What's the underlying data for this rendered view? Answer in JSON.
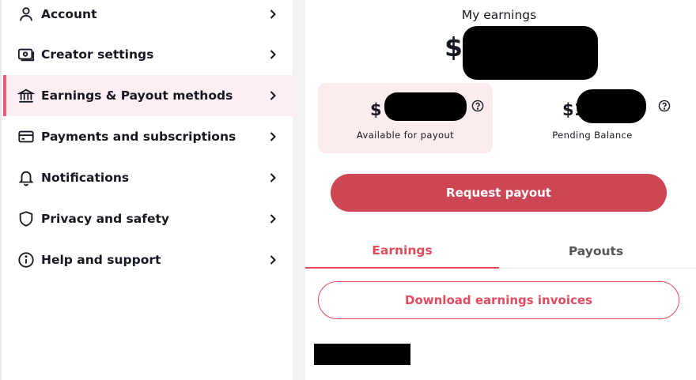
{
  "sidebar": {
    "items": [
      {
        "label": "Account",
        "icon": "person-icon"
      },
      {
        "label": "Creator settings",
        "icon": "money-icon"
      },
      {
        "label": "Earnings & Payout methods",
        "icon": "bank-icon"
      },
      {
        "label": "Payments and subscriptions",
        "icon": "card-icon"
      },
      {
        "label": "Notifications",
        "icon": "bell-icon"
      },
      {
        "label": "Privacy and safety",
        "icon": "shield-icon"
      },
      {
        "label": "Help and support",
        "icon": "info-icon"
      }
    ],
    "active_index": 2
  },
  "earnings": {
    "title": "My earnings",
    "currency_symbol": "$",
    "available": {
      "label": "Available for payout",
      "currency_symbol": "$"
    },
    "pending": {
      "label": "Pending Balance",
      "currency_symbol": "$1"
    },
    "request_button": "Request payout",
    "tabs": [
      {
        "label": "Earnings",
        "active": true
      },
      {
        "label": "Payouts",
        "active": false
      }
    ],
    "download_button": "Download earnings invoices"
  },
  "colors": {
    "accent": "#e04b5e",
    "request_button_bg": "#cd4654",
    "active_item_bg": "#fdeff1",
    "card_bg": "#fdeced"
  }
}
